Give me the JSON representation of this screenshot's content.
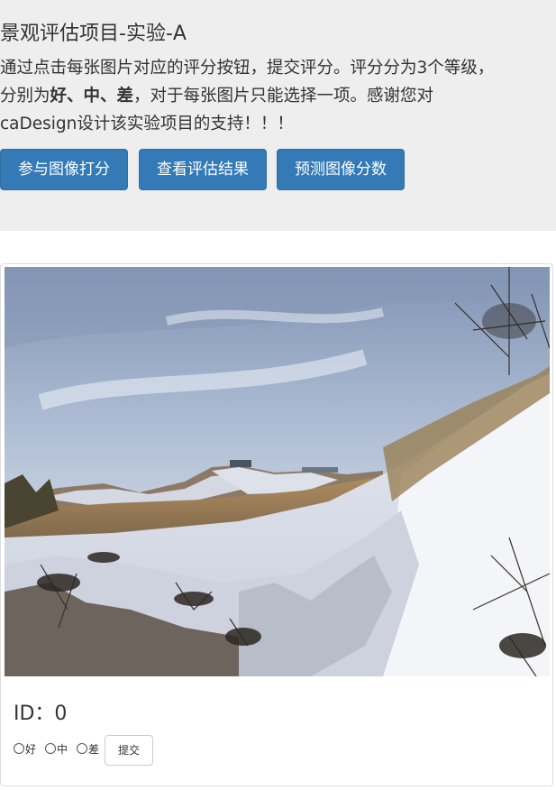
{
  "header": {
    "title": "景观评估项目-实验-A",
    "intro": {
      "line1": "通过点击每张图片对应的评分按钮，提交评分。评分分为3个等级，",
      "line2_prefix": "分别为",
      "line2_bold": "好、中、差",
      "line2_suffix": "，对于每张图片只能选择一项。感谢您对",
      "line3": "caDesign设计该实验项目的支持！！！"
    },
    "buttons": [
      {
        "label": "参与图像打分"
      },
      {
        "label": "查看评估结果"
      },
      {
        "label": "预测图像分数"
      }
    ],
    "background_color": "#eeeeee",
    "button_color": "#337ab7"
  },
  "card": {
    "image_alt": "snowy hillside landscape",
    "id_label": "ID：0",
    "options": [
      {
        "label": "好",
        "checked": false
      },
      {
        "label": "中",
        "checked": false
      },
      {
        "label": "差",
        "checked": false
      }
    ],
    "submit_label": "提交"
  }
}
